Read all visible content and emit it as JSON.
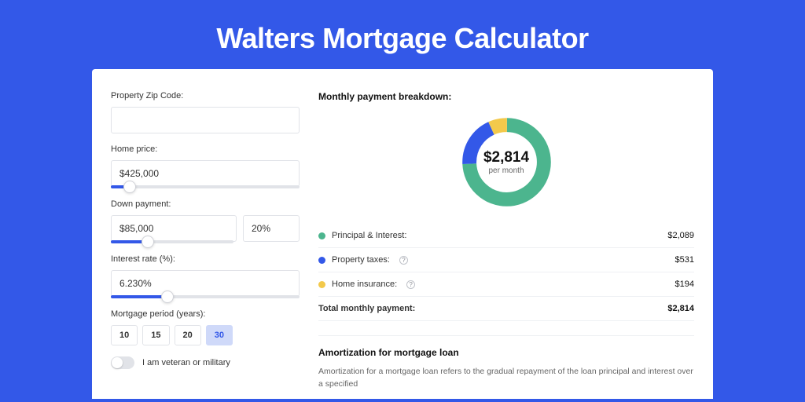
{
  "title": "Walters Mortgage Calculator",
  "form": {
    "zip": {
      "label": "Property Zip Code:",
      "value": ""
    },
    "price": {
      "label": "Home price:",
      "value": "$425,000",
      "slider_pct": 10
    },
    "down": {
      "label": "Down payment:",
      "value": "$85,000",
      "pct": "20%",
      "slider_pct": 20
    },
    "rate": {
      "label": "Interest rate (%):",
      "value": "6.230%",
      "slider_pct": 30
    },
    "period": {
      "label": "Mortgage period (years):",
      "options": [
        "10",
        "15",
        "20",
        "30"
      ],
      "selected": "30"
    },
    "veteran": {
      "label": "I am veteran or military",
      "on": false
    }
  },
  "breakdown": {
    "title": "Monthly payment breakdown:",
    "total": "$2,814",
    "per": "per month",
    "items": [
      {
        "label": "Principal & Interest:",
        "value": "$2,089",
        "color": "green"
      },
      {
        "label": "Property taxes:",
        "value": "$531",
        "color": "blue",
        "info": true
      },
      {
        "label": "Home insurance:",
        "value": "$194",
        "color": "yellow",
        "info": true
      }
    ],
    "total_label": "Total monthly payment:",
    "total_value": "$2,814"
  },
  "amort": {
    "title": "Amortization for mortgage loan",
    "text": "Amortization for a mortgage loan refers to the gradual repayment of the loan principal and interest over a specified"
  },
  "chart_data": {
    "type": "pie",
    "title": "Monthly payment breakdown",
    "series": [
      {
        "name": "Principal & Interest",
        "value": 2089,
        "color": "#4cb58e"
      },
      {
        "name": "Property taxes",
        "value": 531,
        "color": "#3358e8"
      },
      {
        "name": "Home insurance",
        "value": 194,
        "color": "#f3c94b"
      }
    ],
    "total": 2814,
    "center_label": "$2,814 per month"
  }
}
